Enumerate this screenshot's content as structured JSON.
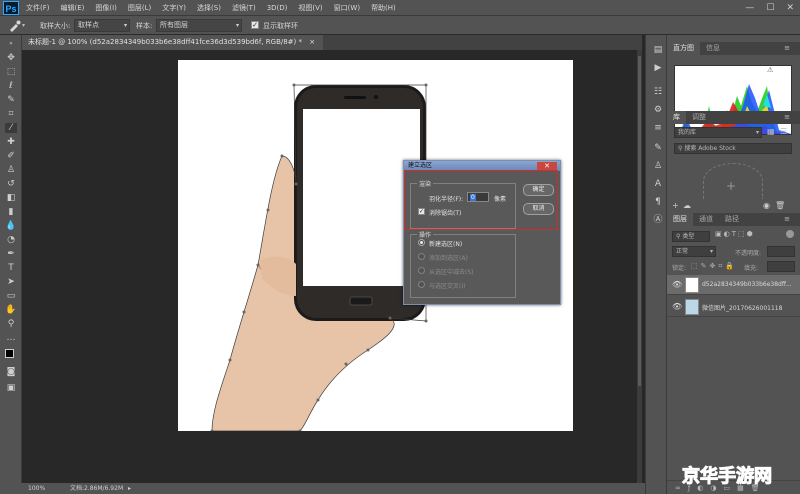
{
  "app": {
    "logo": "Ps"
  },
  "menubar": {
    "items": [
      "文件(F)",
      "编辑(E)",
      "图像(I)",
      "图层(L)",
      "文字(Y)",
      "选择(S)",
      "滤镜(T)",
      "3D(D)",
      "视图(V)",
      "窗口(W)",
      "帮助(H)"
    ],
    "window_controls": {
      "minimize": "—",
      "restore": "☐",
      "close": "✕"
    }
  },
  "options": {
    "sample_size_label": "取样大小:",
    "sample_size_value": "取样点",
    "sample_label": "样本:",
    "sample_value": "所有图层",
    "show_ring_label": "显示取样环",
    "show_ring_checked": true
  },
  "document": {
    "tab_title": "未标题-1 @ 100% (d52a2834349b033b6e38dff41fce36d3d539bd6f, RGB/8#) *",
    "tab_close": "×",
    "zoom": "100%",
    "doc_info": "文档:2.86M/6.92M"
  },
  "tools": [
    "move",
    "marquee",
    "lasso",
    "quick-select",
    "crop",
    "eyedropper",
    "heal",
    "brush",
    "clone",
    "history-brush",
    "eraser",
    "gradient",
    "blur",
    "dodge",
    "pen",
    "type",
    "path-select",
    "shape",
    "hand",
    "zoom",
    "more",
    "colors",
    "quick-mask",
    "screen-mode"
  ],
  "panels": {
    "histogram": {
      "tabs": [
        "直方图",
        "信息"
      ],
      "warning": "⚠"
    },
    "libraries": {
      "tabs": [
        "库",
        "调整"
      ],
      "library_name": "我的库",
      "search_placeholder": "搜索 Adobe Stock"
    },
    "layers": {
      "tabs": [
        "图层",
        "通道",
        "路径"
      ],
      "filter_kind": "类型",
      "blend_mode": "正常",
      "opacity_label": "不透明度:",
      "lock_label": "锁定:",
      "fill_label": "填充:",
      "items": [
        {
          "name": "d52a2834349b033b6e38dff...",
          "visible": true
        },
        {
          "name": "微信图片_20170626001118",
          "visible": true
        }
      ]
    }
  },
  "dialog": {
    "title": "建立选区",
    "close": "✕",
    "render_group": "渲染",
    "feather_label": "羽化半径(F):",
    "feather_value": "0",
    "feather_unit": "像素",
    "antialias_label": "消除锯齿(T)",
    "antialias_checked": true,
    "operation_group": "操作",
    "options": [
      {
        "label": "新建选区(N)",
        "selected": true,
        "enabled": true
      },
      {
        "label": "添加到选区(A)",
        "selected": false,
        "enabled": false
      },
      {
        "label": "从选区中减去(S)",
        "selected": false,
        "enabled": false
      },
      {
        "label": "与选区交叉(I)",
        "selected": false,
        "enabled": false
      }
    ],
    "ok_button": "确定",
    "cancel_button": "取消",
    "highlight_color": "#d42a2a"
  },
  "watermark": {
    "text": "京华手游网",
    "color": "#1d78c8"
  }
}
